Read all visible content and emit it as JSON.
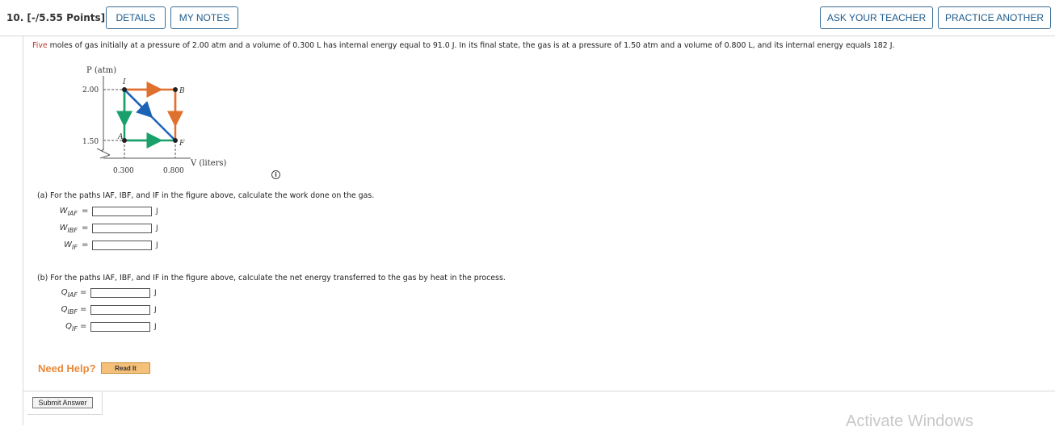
{
  "header": {
    "question_number": "10. [-/5.55 Points]",
    "details_label": "DETAILS",
    "my_notes_label": "MY NOTES",
    "ask_teacher_label": "ASK YOUR TEACHER",
    "practice_another_label": "PRACTICE ANOTHER"
  },
  "problem": {
    "highlight": "Five",
    "text": " moles of gas initially at a pressure of 2.00 atm and a volume of 0.300 L has internal energy equal to 91.0 J. In its final state, the gas is at a pressure of 1.50 atm and a volume of 0.800 L, and its internal energy equals 182 J."
  },
  "figure": {
    "y_axis_label": "P (atm)",
    "x_axis_label": "V (liters)",
    "y_tick_top": "2.00",
    "y_tick_bottom": "1.50",
    "x_tick_left": "0.300",
    "x_tick_right": "0.800",
    "point_I": "I",
    "point_B": "B",
    "point_A": "A",
    "point_F": "F",
    "colors": {
      "orange": "#e0702e",
      "green": "#1aa06a",
      "blue": "#1c63b8"
    }
  },
  "part_a": {
    "prompt": "(a)   For the paths IAF, IBF, and IF in the figure above, calculate the work done on the gas.",
    "rows": [
      {
        "var": "W",
        "sub": "IAF",
        "eq": "=",
        "value": "",
        "unit": "J"
      },
      {
        "var": "W",
        "sub": "IBF",
        "eq": "=",
        "value": "",
        "unit": "J"
      },
      {
        "var": "W",
        "sub": "IF",
        "eq": "=",
        "value": "",
        "unit": "J"
      }
    ]
  },
  "part_b": {
    "prompt": "(b)   For the paths IAF, IBF, and IF in the figure above, calculate the net energy transferred to the gas by heat in the process.",
    "rows": [
      {
        "var": "Q",
        "sub": "IAF",
        "eq": "=",
        "value": "",
        "unit": "J"
      },
      {
        "var": "Q",
        "sub": "IBF",
        "eq": "=",
        "value": "",
        "unit": "J"
      },
      {
        "var": "Q",
        "sub": "IF",
        "eq": "=",
        "value": "",
        "unit": "J"
      }
    ]
  },
  "help": {
    "need_help": "Need Help?",
    "read_it": "Read It"
  },
  "submit_label": "Submit Answer",
  "info_glyph": "i",
  "watermark": "Activate Windows"
}
